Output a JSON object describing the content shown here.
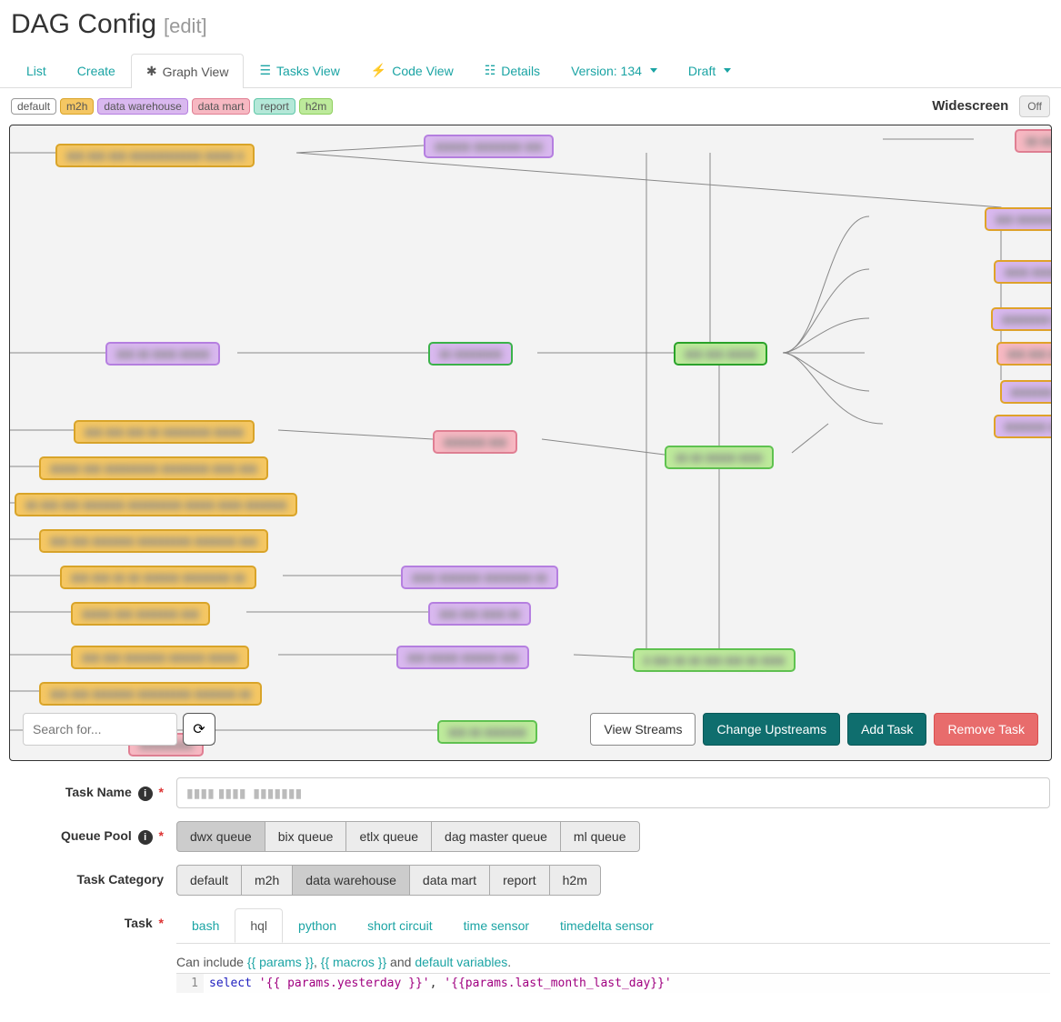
{
  "header": {
    "title": "DAG Config",
    "edit": "[edit]"
  },
  "tabs": {
    "list": "List",
    "create": "Create",
    "graph": "Graph View",
    "tasks": "Tasks View",
    "code": "Code View",
    "details": "Details",
    "version": "Version: 134",
    "draft": "Draft"
  },
  "tags": {
    "default": "default",
    "m2h": "m2h",
    "dw": "data warehouse",
    "dm": "data mart",
    "report": "report",
    "h2m": "h2m"
  },
  "widescreen": {
    "label": "Widescreen",
    "state": "Off"
  },
  "graph": {
    "search_placeholder": "Search for...",
    "btn_view_streams": "View Streams",
    "btn_change_upstreams": "Change Upstreams",
    "btn_add_task": "Add Task",
    "btn_remove_task": "Remove Task",
    "nodes": {
      "n_top_left_orange": "▮▮▮ ▮▮▮ ▮▮▮ ▮▮▮▮▮▮▮▮▮▮▮▮ ▮▮▮▮▮ ▮",
      "n_top_mid_purple": "▮▮▮▮▮▮ ▮▮▮▮▮▮▮▮ ▮▮▮",
      "n_top_right_pink": "▮▮ ▮▮▮▮▮▮ ▮▮▮▮",
      "n_r1": "▮▮▮ ▮▮▮▮▮▮▮ ▮▮ ▮▮▮",
      "n_r2": "▮▮▮▮ ▮▮▮▮▮ ▮▮▮ ▮▮▮",
      "n_r3": "▮▮▮▮▮▮▮▮ ▮▮▮▮▮▮▮▮ ▮▮▮",
      "n_r4": "▮▮▮ ▮▮▮ ▮▮▮",
      "n_r5": "▮▮▮▮▮▮▮ ▮▮▮ ▮▮ ▮▮",
      "n_r6": "▮▮▮▮▮▮▮ ▮▮▮",
      "n_left_mid_purple": "▮▮▮ ▮▮ ▮▮▮▮ ▮▮▮▮▮",
      "n_mid_green": "▮▮ ▮▮▮▮▮▮▮▮",
      "n_right_mid_green": "▮▮▮ ▮▮▮ ▮▮▮▮▮",
      "n_o1": "▮▮▮ ▮▮▮ ▮▮▮ ▮▮ ▮▮▮▮▮▮▮▮ ▮▮▮▮▮",
      "n_pink_mid": "▮▮▮▮▮▮▮ ▮▮▮",
      "n_green_mid2": "▮▮ ▮▮ ▮▮▮▮▮ ▮▮▮▮",
      "n_o2": "▮▮▮▮▮ ▮▮▮ ▮▮▮▮▮▮▮▮▮ ▮▮▮▮▮▮▮▮ ▮▮▮▮ ▮▮▮",
      "n_o3": "▮▮ ▮▮▮ ▮▮▮ ▮▮▮▮▮▮▮ ▮▮▮▮▮▮▮▮▮ ▮▮▮▮▮ ▮▮▮▮ ▮▮▮▮▮▮▮",
      "n_o4": "▮▮▮ ▮▮▮ ▮▮▮▮▮▮▮ ▮▮▮▮▮▮▮▮▮ ▮▮▮▮▮▮▮ ▮▮▮",
      "n_o5": "▮▮▮ ▮▮▮ ▮▮ ▮▮ ▮▮▮▮▮▮ ▮▮▮▮▮▮▮▮ ▮▮",
      "n_p5": "▮▮▮▮ ▮▮▮▮▮▮▮ ▮▮▮▮▮▮▮▮ ▮▮",
      "n_o6": "▮▮▮▮▮ ▮▮▮ ▮▮▮▮▮▮▮ ▮▮▮",
      "n_p6": "▮▮▮ ▮▮▮ ▮▮▮▮ ▮▮",
      "n_o7": "▮▮▮ ▮▮▮ ▮▮▮▮▮▮▮ ▮▮▮▮▮▮ ▮▮▮▮▮",
      "n_p7": "▮▮▮ ▮▮▮▮▮ ▮▮▮▮▮▮ ▮▮▮",
      "n_g7": "▮ ▮▮▮ ▮▮ ▮▮ ▮▮▮ ▮▮▮ ▮▮ ▮▮▮▮",
      "n_o8": "▮▮▮ ▮▮▮ ▮▮▮▮▮▮▮ ▮▮▮▮▮▮▮▮▮ ▮▮▮▮▮▮▮ ▮▮",
      "n_pink_bottom": "▮▮▮▮▮▮▮▮▮",
      "n_gbottom": "▮▮▮ ▮▮ ▮▮▮▮▮▮▮"
    }
  },
  "form": {
    "task_name": {
      "label": "Task Name",
      "value": "▮▮▮▮ ▮▮▮▮  ▮▮▮▮▮▮▮"
    },
    "queue_pool": {
      "label": "Queue Pool",
      "options": [
        "dwx queue",
        "bix queue",
        "etlx queue",
        "dag master queue",
        "ml queue"
      ],
      "selected": 0
    },
    "task_category": {
      "label": "Task Category",
      "options": [
        "default",
        "m2h",
        "data warehouse",
        "data mart",
        "report",
        "h2m"
      ],
      "selected": 2
    },
    "task": {
      "label": "Task",
      "tabs": [
        "bash",
        "hql",
        "python",
        "short circuit",
        "time sensor",
        "timedelta sensor"
      ],
      "selected": 1
    },
    "hint": {
      "prefix": "Can include ",
      "params": "{{ params }}",
      "sep": ", ",
      "macros": "{{ macros }}",
      "mid": " and ",
      "defaults": "default variables",
      "suffix": "."
    },
    "editor": {
      "line_no": "1",
      "kw": "select",
      "s1": " '{{ params.yesterday }}'",
      "comma": ", ",
      "s2": "'{{params.last_month_last_day}}'"
    }
  }
}
